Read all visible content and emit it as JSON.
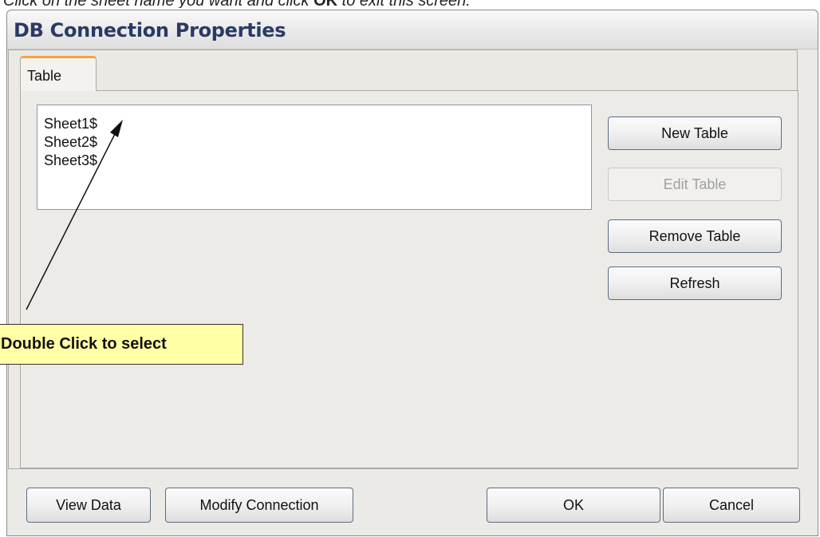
{
  "instruction": {
    "pre": "Click on the sheet name you want and click ",
    "bold": "OK",
    "post": " to exit this screen."
  },
  "dialog": {
    "title": "DB Connection Properties",
    "tab_label": "Table",
    "tables": [
      "Sheet1$",
      "Sheet2$",
      "Sheet3$"
    ],
    "buttons": {
      "new_table": "New Table",
      "edit_table": "Edit Table",
      "remove_table": "Remove Table",
      "refresh": "Refresh",
      "view_data": "View Data",
      "modify_connection": "Modify Connection",
      "ok": "OK",
      "cancel": "Cancel"
    }
  },
  "callout": {
    "text": "Double Click to select"
  },
  "colors": {
    "callout_bg": "#ffffa6",
    "tab_accent": "#f2a43c",
    "title_text": "#2a3a64"
  }
}
